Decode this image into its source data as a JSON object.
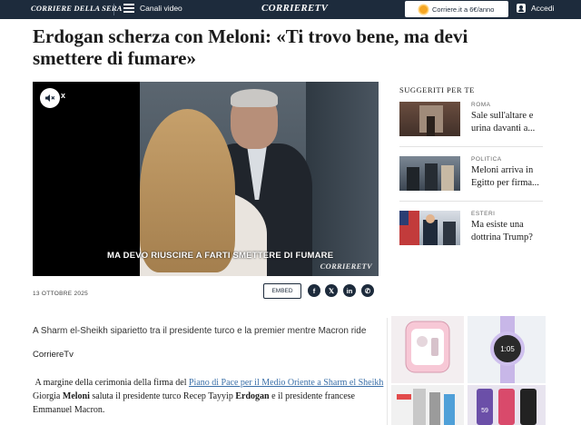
{
  "nav": {
    "brand": "CORRIERE DELLA SERA",
    "menu_label": "Canali video",
    "logo": "CORRIERETV",
    "promo": "Corriere.it a 6€/anno",
    "login": "Accedi",
    "colors": {
      "bar": "#1d2b3c",
      "promo_icon": "#f5a623"
    }
  },
  "article": {
    "headline": "Erdogan scherza con Meloni: «Ti trovo bene, ma devi smettere di fumare»",
    "video": {
      "caption": "MA DEVO RIUSCIRE A FARTI SMETTERE DI FUMARE",
      "logo": "CORRIERETV",
      "close": "x",
      "mute_icon": "speaker-muted-icon"
    },
    "date": "13 OTTOBRE 2025",
    "embed_label": "EMBED",
    "share": [
      {
        "name": "facebook",
        "glyph": "f"
      },
      {
        "name": "x",
        "glyph": "𝕏"
      },
      {
        "name": "linkedin",
        "glyph": "in"
      },
      {
        "name": "whatsapp",
        "glyph": "✆"
      }
    ],
    "summary": "A Sharm el-Sheikh siparietto tra il presidente turco e la premier mentre Macron ride",
    "source": "CorriereTv",
    "body_prefix": "A margine della cerimonia della firma del ",
    "body_link": "Piano di Pace per il Medio Oriente a Sharm el Sheikh",
    "body_part1": " Giorgia ",
    "body_bold1": "Meloni",
    "body_part2": " saluta il presidente turco Recep Tayyip ",
    "body_bold2": "Erdogan",
    "body_part3": " e il presidente francese Emmanuel Macron."
  },
  "sidebar": {
    "title": "SUGGERITI PER TE",
    "items": [
      {
        "category": "ROMA",
        "title": "Sale sull'altare e urina davanti a..."
      },
      {
        "category": "POLITICA",
        "title": "Meloni arriva in Egitto per firma..."
      },
      {
        "category": "ESTERI",
        "title": "Ma esiste una dottrina Trump?"
      }
    ]
  },
  "ads": {
    "watch_time_1": "1:05",
    "watch_time_2": "59"
  }
}
